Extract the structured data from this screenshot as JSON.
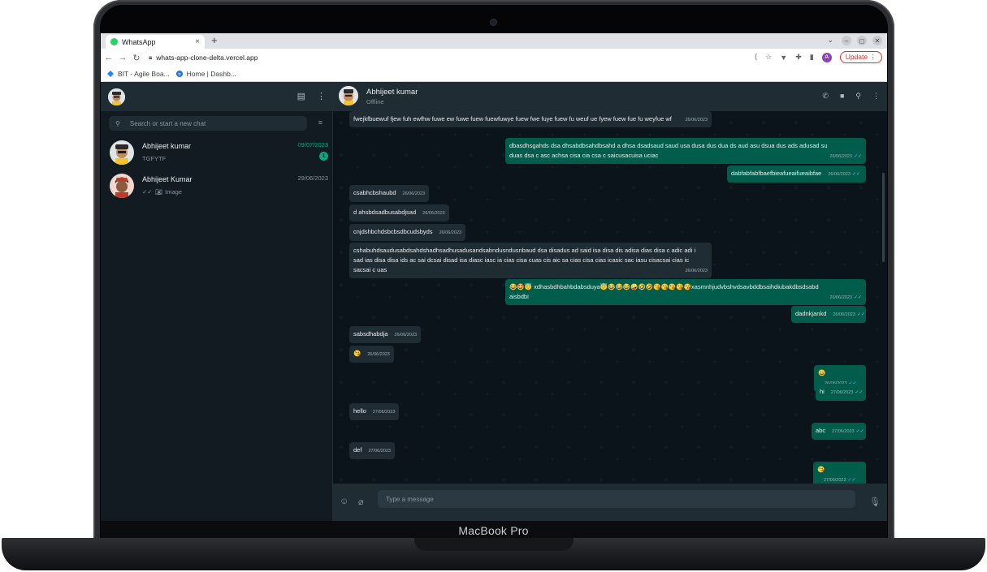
{
  "device": {
    "label": "MacBook Pro"
  },
  "browser": {
    "tab_title": "WhatsApp",
    "tab_close": "×",
    "new_tab": "+",
    "url": "whats-app-clone-delta.vercel.app",
    "profile_initial": "A",
    "update_label": "Update",
    "bookmarks": [
      {
        "label": "BIT - Agile Boa...",
        "icon": "jira-icon"
      },
      {
        "label": "Home | Dashb...",
        "icon": "dashboard-icon"
      }
    ]
  },
  "sidebar": {
    "search_placeholder": "Search or start a new chat",
    "chats": [
      {
        "name": "Abhijeet kumar",
        "preview": "TGFYTF",
        "time": "09/07/2023",
        "unread": "1"
      },
      {
        "name": "Abhijeet Kumar",
        "preview": "Image",
        "time": "29/06/2023"
      }
    ]
  },
  "conversation": {
    "contact_name": "Abhijeet kumar",
    "contact_status": "Offline",
    "compose_placeholder": "Type a message",
    "messages": [
      {
        "dir": "in",
        "text": "fwejkfbuewuf fjew fuh ewfhw fuwe ew fuwe fuew fuewfuwye fuew fwe fuye fuew fu weuf ue fyew fuew fue fu weyfue wf",
        "time": "26/06/2023"
      },
      {
        "dir": "out",
        "text": "dbasdhsgahds dsa dhsabdbsahdbsahd a dhsa dsadsaud saud usa dusa dus dua ds aud asu dsua dus ads adusad su duas dsa c asc achsa cisa cia csa c saicusacuisa uciac",
        "time": "26/06/2023"
      },
      {
        "dir": "out",
        "text": "dabfabfabfbaefbieafueaifueaibfae",
        "time": "26/06/2023"
      },
      {
        "dir": "in",
        "text": "csabhcbshaubd",
        "time": "26/06/2023"
      },
      {
        "dir": "in",
        "text": "d ahsbdsadbusabdjsad",
        "time": "26/06/2023"
      },
      {
        "dir": "in",
        "text": "cnjdshbchdsbcbsdbcudsbyds",
        "time": "26/06/2023"
      },
      {
        "dir": "in",
        "text": "cshabuhdsaudusabdsahdshadhsadhusadusandsabndusndusnbaud dsa disadus ad said isa disa dis adisa dias disa c adic adi i sad ias disa disa ids ac sai dcsai disad isa diasc iasc ia cias cisa cuas cis aic sa cias cisa cias icasic sac iasu cisacsai cias ic sacsai c uas",
        "time": "26/06/2023"
      },
      {
        "dir": "out",
        "text": "😂🤩😇 xdhasbdhbahbdabsduya😇😂😂😂🤪🤣🤣😘😘😘😘😘xasmnhjudvbshvdsavbddbsaihdiubakdbsdsabd aisbdbi",
        "time": "26/06/2023"
      },
      {
        "dir": "out",
        "text": "dadnkjankd",
        "time": "26/06/2023"
      },
      {
        "dir": "in",
        "text": "sabsdhabdja",
        "time": "26/06/2023"
      },
      {
        "dir": "in",
        "text": "😘",
        "time": "26/06/2023"
      },
      {
        "dir": "out",
        "text": "😀",
        "time": "26/06/2023"
      },
      {
        "dir": "out",
        "text": "hi",
        "time": "27/06/2023"
      },
      {
        "dir": "in",
        "text": "hello",
        "time": "27/06/2023"
      },
      {
        "dir": "out",
        "text": "abc",
        "time": "27/06/2023"
      },
      {
        "dir": "in",
        "text": "def",
        "time": "27/06/2023"
      },
      {
        "dir": "out",
        "text": "😘",
        "time": "27/06/2023"
      }
    ]
  },
  "colors": {
    "accent": "#00a884",
    "outgoing": "#005c4b",
    "incoming": "#202c33",
    "panel": "#202c33",
    "background": "#0b141a"
  }
}
